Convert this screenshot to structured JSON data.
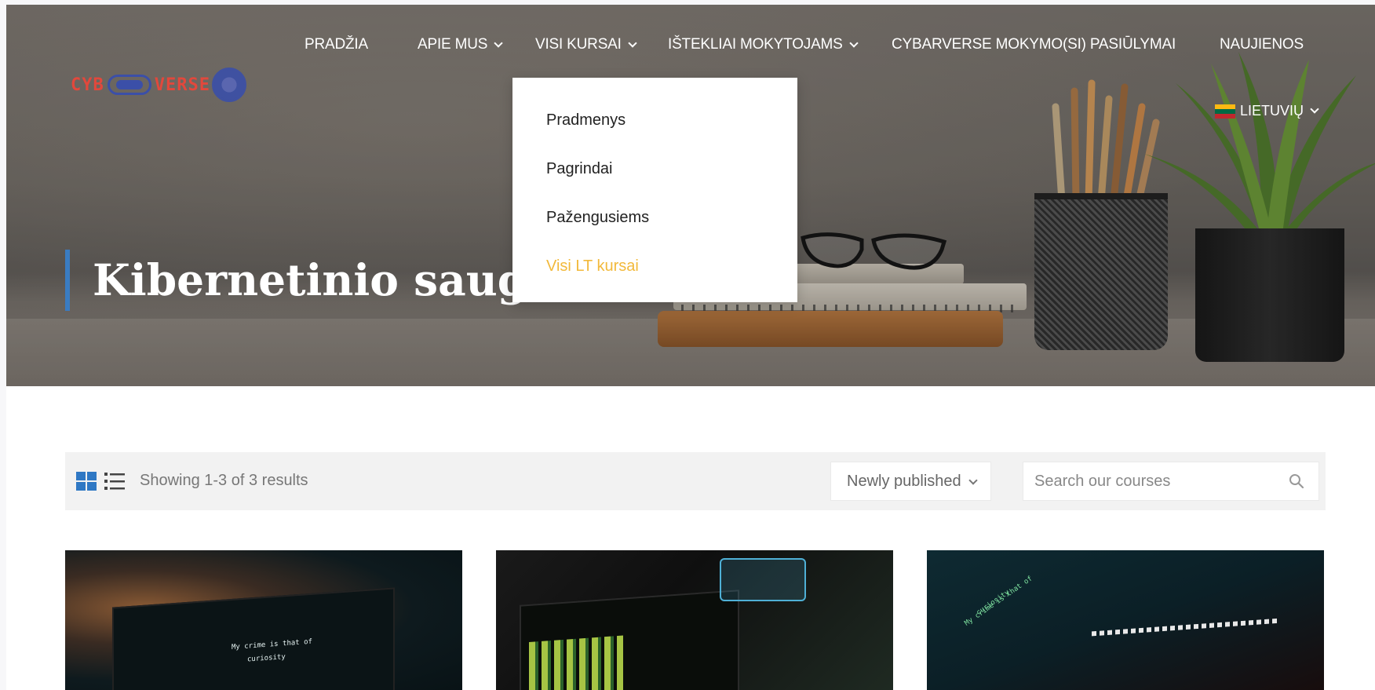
{
  "logo": {
    "text_left": "CYB",
    "text_right": "VERSE"
  },
  "nav": {
    "items": [
      {
        "label": "PRADŽIA",
        "has_dropdown": false
      },
      {
        "label": "APIE MUS",
        "has_dropdown": true
      },
      {
        "label": "VISI KURSAI",
        "has_dropdown": true
      },
      {
        "label": "IŠTEKLIAI MOKYTOJAMS",
        "has_dropdown": true
      },
      {
        "label": "CYBARVERSE MOKYMO(SI) PASIŪLYMAI",
        "has_dropdown": false
      },
      {
        "label": "NAUJIENOS",
        "has_dropdown": false
      }
    ],
    "language": "LIETUVIŲ"
  },
  "dropdown": {
    "items": [
      {
        "label": "Pradmenys",
        "active": false
      },
      {
        "label": "Pagrindai",
        "active": false
      },
      {
        "label": "Pažengusiems",
        "active": false
      },
      {
        "label": "Visi LT kursai",
        "active": true
      }
    ]
  },
  "hero": {
    "title": "Kibernetinio saugumo"
  },
  "toolbar": {
    "results_text": "Showing 1-3 of 3 results",
    "sort_selected": "Newly published",
    "search_placeholder": "Search our courses"
  },
  "cards": [
    {
      "screen_text_1": "My crime is that of",
      "screen_text_2": "curiosity"
    },
    {},
    {
      "screen_text_1": "My crime is that of",
      "screen_text_2": "curiosity"
    }
  ],
  "colors": {
    "accent_blue": "#3a7cc2",
    "dropdown_active": "#f2b93b",
    "logo_red": "#e2483c",
    "logo_blue": "#3b4fa8"
  }
}
